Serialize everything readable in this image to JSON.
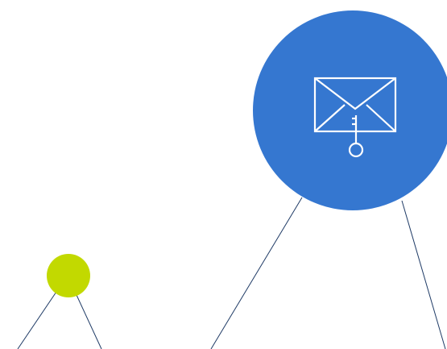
{
  "colors": {
    "background": "#ffffff",
    "primary_node": "#3577d0",
    "secondary_node": "#c2d900",
    "connector_line": "#1f3b66",
    "icon_stroke": "#ffffff"
  },
  "icons": {
    "primary_node_icon": "envelope-key-icon"
  }
}
